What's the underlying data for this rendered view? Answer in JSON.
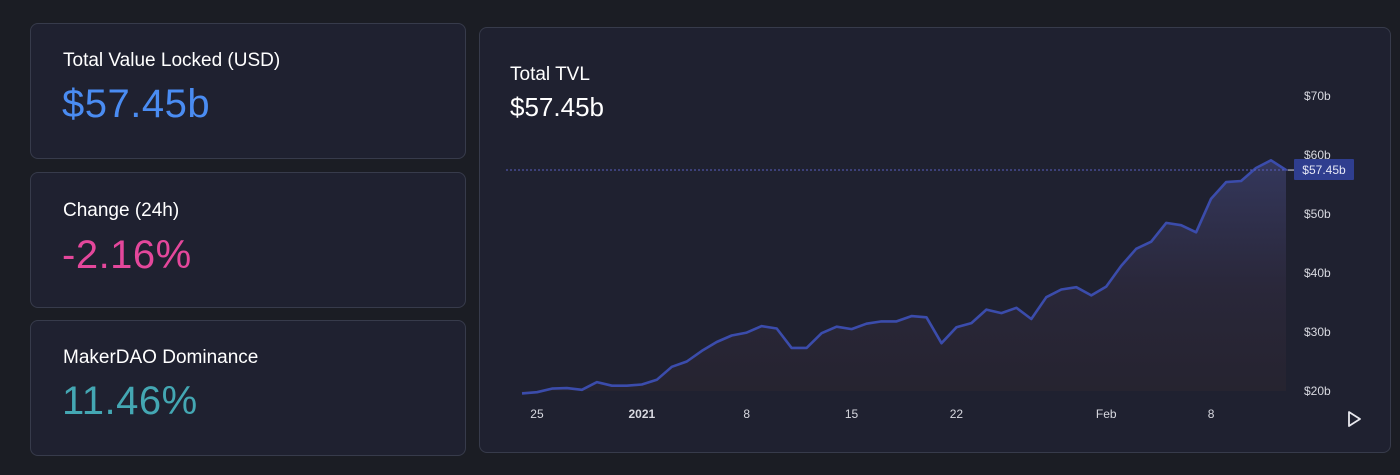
{
  "stats": {
    "tvl": {
      "label": "Total Value Locked (USD)",
      "value": "$57.45b",
      "color": "#4a8cf2"
    },
    "change": {
      "label": "Change (24h)",
      "value": "-2.16%",
      "color": "#e4479b"
    },
    "dominance": {
      "label": "MakerDAO Dominance",
      "value": "11.46%",
      "color": "#44a7b3"
    }
  },
  "chart": {
    "title": "Total TVL",
    "value": "$57.45b",
    "current_price_label": "$57.45b",
    "line_color": "#3b4cab"
  },
  "chart_data": {
    "type": "area",
    "title": "Total TVL",
    "x_tick_labels": [
      {
        "label": "25",
        "index": 1,
        "bold": false
      },
      {
        "label": "2021",
        "index": 8,
        "bold": true
      },
      {
        "label": "8",
        "index": 15,
        "bold": false
      },
      {
        "label": "15",
        "index": 22,
        "bold": false
      },
      {
        "label": "22",
        "index": 29,
        "bold": false
      },
      {
        "label": "Feb",
        "index": 39,
        "bold": false
      },
      {
        "label": "8",
        "index": 46,
        "bold": false
      }
    ],
    "y_tick_labels": [
      "$20b",
      "$30b",
      "$40b",
      "$50b",
      "$60b",
      "$70b"
    ],
    "y_tick_values": [
      20,
      30,
      40,
      50,
      60,
      70
    ],
    "ylim": [
      20,
      70
    ],
    "current_value": 57.45,
    "series": [
      {
        "values": [
          19.6,
          19.8,
          20.4,
          20.5,
          20.2,
          21.5,
          20.9,
          20.9,
          21.1,
          21.9,
          24.1,
          25.0,
          26.8,
          28.3,
          29.4,
          29.9,
          31.0,
          30.6,
          27.3,
          27.3,
          29.8,
          30.9,
          30.5,
          31.4,
          31.8,
          31.8,
          32.7,
          32.5,
          28.1,
          30.8,
          31.5,
          33.8,
          33.2,
          34.1,
          32.2,
          35.9,
          37.2,
          37.6,
          36.2,
          37.7,
          41.2,
          44.1,
          45.3,
          48.5,
          48.1,
          46.9,
          52.6,
          55.4,
          55.6,
          57.8,
          59.1,
          57.45
        ]
      }
    ]
  }
}
